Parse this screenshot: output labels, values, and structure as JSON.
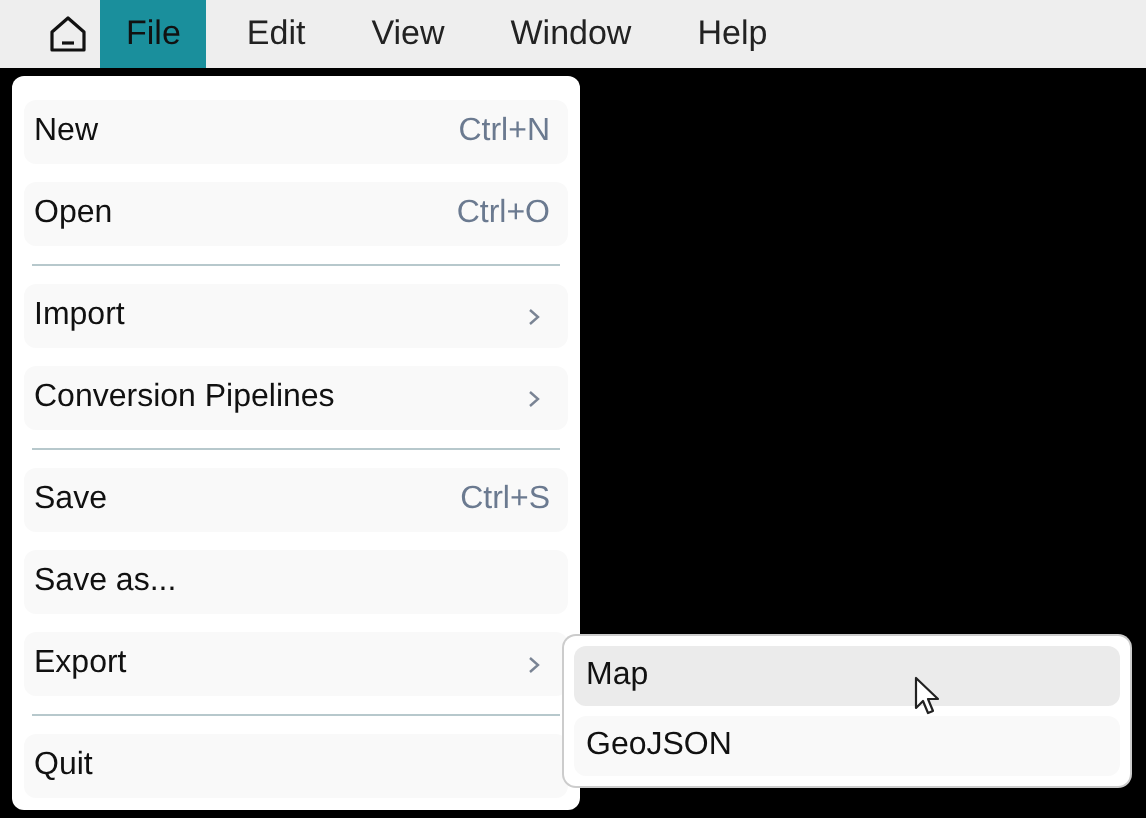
{
  "menubar": [
    {
      "label": "File",
      "selected": true
    },
    {
      "label": "Edit",
      "selected": false
    },
    {
      "label": "View",
      "selected": false
    },
    {
      "label": "Window",
      "selected": false
    },
    {
      "label": "Help",
      "selected": false
    }
  ],
  "file_menu": [
    {
      "kind": "item",
      "label": "New",
      "shortcut": "Ctrl+N"
    },
    {
      "kind": "item",
      "label": "Open",
      "shortcut": "Ctrl+O"
    },
    {
      "kind": "separator"
    },
    {
      "kind": "item",
      "label": "Import",
      "submenu": true
    },
    {
      "kind": "item",
      "label": "Conversion Pipelines",
      "submenu": true
    },
    {
      "kind": "separator"
    },
    {
      "kind": "item",
      "label": "Save",
      "shortcut": "Ctrl+S"
    },
    {
      "kind": "item",
      "label": "Save as..."
    },
    {
      "kind": "item",
      "label": "Export",
      "submenu": true
    },
    {
      "kind": "separator"
    },
    {
      "kind": "item",
      "label": "Quit"
    }
  ],
  "export_submenu": [
    {
      "label": "Map",
      "selected": true
    },
    {
      "label": "GeoJSON",
      "selected": false
    }
  ]
}
